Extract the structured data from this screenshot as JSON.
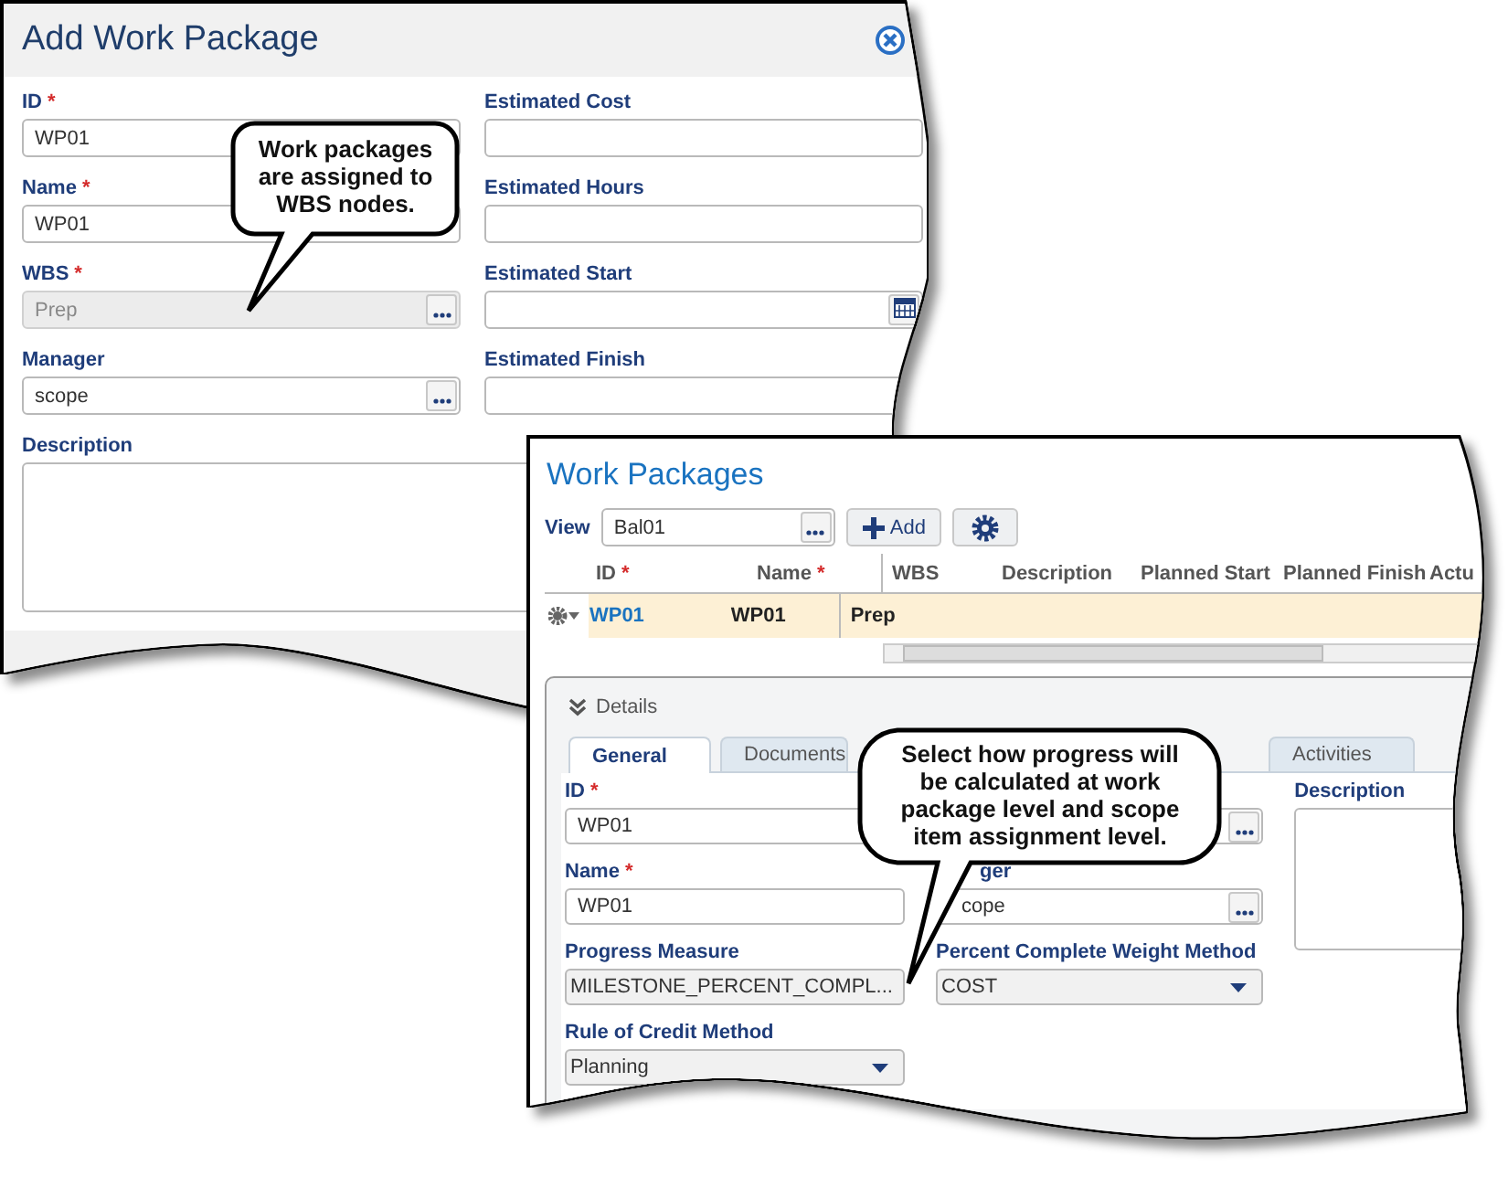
{
  "add_dialog": {
    "title": "Add Work Package",
    "left_fields": [
      {
        "label": "ID",
        "required_mark": "*",
        "kind": "text",
        "value": "WP01",
        "disabled": false
      },
      {
        "label": "Name",
        "required_mark": "*",
        "kind": "text",
        "value": "WP01",
        "disabled": false
      },
      {
        "label": "WBS",
        "required_mark": "*",
        "kind": "lookup",
        "value": "Prep",
        "disabled": true
      },
      {
        "label": "Manager",
        "kind": "lookup",
        "value": "scope",
        "disabled": false
      },
      {
        "label": "Description",
        "kind": "textarea"
      }
    ],
    "right_fields": [
      {
        "label": "Estimated Cost",
        "kind": "text",
        "disabled": false
      },
      {
        "label": "Estimated Hours",
        "kind": "text",
        "disabled": false
      },
      {
        "label": "Estimated Start",
        "kind": "date",
        "disabled": false
      },
      {
        "label": "Estimated Finish",
        "kind": "text",
        "disabled": false
      }
    ]
  },
  "work_packages": {
    "title": "Work Packages",
    "view_label": "View",
    "view_value": "Bal01",
    "add_button": "Add",
    "columns": [
      {
        "label": "ID",
        "required_mark": "*"
      },
      {
        "label": "Name",
        "required_mark": "*"
      },
      {
        "label": "WBS"
      },
      {
        "label": "Description"
      },
      {
        "label": "Planned Start"
      },
      {
        "label": "Planned Finish"
      },
      {
        "label": "Actu"
      }
    ],
    "rows": [
      {
        "selected": true,
        "cells": [
          "WP01",
          "WP01",
          "Prep"
        ]
      }
    ],
    "details": {
      "title": "Details",
      "tabs": [
        {
          "label": "General",
          "selected": true
        },
        {
          "label": "Documents",
          "selected": false
        },
        {
          "label": "Activities",
          "selected": false
        }
      ],
      "left_fields": [
        {
          "label": "ID",
          "required_mark": "*",
          "kind": "text",
          "value": "WP01"
        },
        {
          "label": "Name",
          "required_mark": "*",
          "kind": "text",
          "value": "WP01"
        },
        {
          "label": "Progress Measure",
          "kind": "dropdown",
          "value": "MILESTONE_PERCENT_COMPL..."
        },
        {
          "label": "Rule of Credit Method",
          "kind": "dropdown",
          "value": "Planning"
        }
      ],
      "middle_fields": [
        {
          "kind": "lookup"
        },
        {
          "label": "ger",
          "kind": "lookup",
          "value": "cope"
        },
        {
          "label": "Percent Complete Weight Method",
          "kind": "dropdown",
          "value": "COST"
        }
      ],
      "right_fields": [
        {
          "label": "Description",
          "kind": "textarea"
        }
      ]
    }
  },
  "callouts": [
    {
      "text": "Work packages are assigned to WBS nodes."
    },
    {
      "text": "Select how progress will be calculated at work package level and scope item assignment level."
    }
  ]
}
